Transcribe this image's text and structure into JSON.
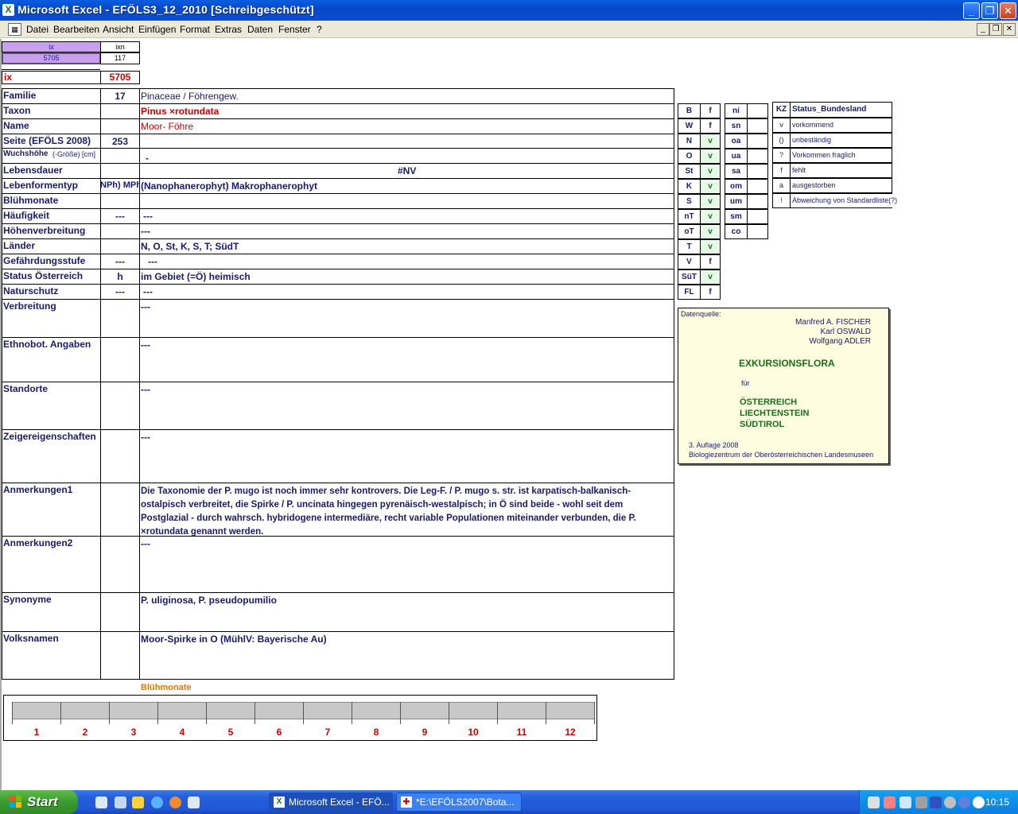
{
  "window": {
    "title": "Microsoft Excel - EFÖLS3_12_2010  [Schreibgeschützt]"
  },
  "menu": [
    "Datei",
    "Bearbeiten",
    "Ansicht",
    "Einfügen",
    "Format",
    "Extras",
    "Daten",
    "Fenster",
    "?"
  ],
  "top_cells": {
    "ix_head": "ix",
    "ixn_head": "ixn",
    "ix_val": "5705",
    "ixn_val": "117",
    "ix_label": "ix",
    "ix_big": "5705"
  },
  "fields": [
    {
      "label": "Familie",
      "code": "17",
      "value": "Pinaceae  /  Föhrengew."
    },
    {
      "label": "Taxon",
      "code": "",
      "value": "Pinus ×rotundata"
    },
    {
      "label": "Name",
      "code": "",
      "value": "Moor- Föhre"
    },
    {
      "label": "Seite (EFÖLS 2008)",
      "code": "253",
      "value": ""
    },
    {
      "label": "Wuchshöhe",
      "label_suffix": "(-Größe) [cm]",
      "code": "",
      "value": "-"
    },
    {
      "label": "Lebensdauer",
      "code": "",
      "value": "#NV"
    },
    {
      "label": "Lebenformentyp",
      "code": "NPh) MPh",
      "value": "(Nanophanerophyt) Makrophanerophyt"
    },
    {
      "label": "Blühmonate",
      "code": "",
      "value": ""
    },
    {
      "label": "Häufigkeit",
      "code": "---",
      "value": "---"
    },
    {
      "label": "Höhenverbreitung",
      "code": "",
      "value": "---"
    },
    {
      "label": "Länder",
      "code": "",
      "value": "N, O, St, K, S, T; SüdT"
    },
    {
      "label": "Gefährdungsstufe",
      "code": "---",
      "value": "---"
    },
    {
      "label": "Status Österreich",
      "code": "h",
      "value": "im Gebiet (=Ö) heimisch"
    },
    {
      "label": "Naturschutz",
      "code": "---",
      "value": "---"
    },
    {
      "label": "Verbreitung",
      "code": "",
      "value": "---"
    },
    {
      "label": "Ethnobot. Angaben",
      "code": "",
      "value": "---"
    },
    {
      "label": "Standorte",
      "code": "",
      "value": "---"
    },
    {
      "label": "Zeigereigenschaften",
      "code": "",
      "value": "---"
    },
    {
      "label": "Anmerkungen1",
      "code": "",
      "value": "Die Taxonomie der P. mugo ist noch immer sehr kontrovers. Die Leg-F. / P. mugo s. str. ist karpatisch-balkanisch-ostalpisch verbreitet, die Spirke / P. uncinata hingegen pyrenäisch-westalpisch; in Ö sind beide - wohl seit dem Postglazial - durch wahrsch. hybridogene intermediäre, recht variable Populationen miteinander verbunden, die P. ×rotundata genannt werden."
    },
    {
      "label": "Anmerkungen2",
      "code": "",
      "value": "---"
    },
    {
      "label": "Synonyme",
      "code": "",
      "value": "P. uliginosa, P. pseudopumilio"
    },
    {
      "label": "Volksnamen",
      "code": "",
      "value": "Moor-Spirke in O (MühlV: Bayerische Au)"
    }
  ],
  "regions": [
    {
      "code": "B",
      "val": "f"
    },
    {
      "code": "W",
      "val": "f"
    },
    {
      "code": "N",
      "val": "v"
    },
    {
      "code": "O",
      "val": "v"
    },
    {
      "code": "St",
      "val": "v"
    },
    {
      "code": "K",
      "val": "v"
    },
    {
      "code": "S",
      "val": "v"
    },
    {
      "code": "nT",
      "val": "v"
    },
    {
      "code": "oT",
      "val": "v"
    },
    {
      "code": "T",
      "val": "v"
    },
    {
      "code": "V",
      "val": "f"
    },
    {
      "code": "SüT",
      "val": "v"
    },
    {
      "code": "FL",
      "val": "f"
    }
  ],
  "altitude": [
    "ni",
    "sn",
    "oa",
    "ua",
    "sa",
    "om",
    "um",
    "sm",
    "co"
  ],
  "legend": {
    "head_kz": "KZ",
    "head_status": "Status_Bundesland",
    "rows": [
      {
        "kz": "v",
        "text": "vorkommend"
      },
      {
        "kz": "()",
        "text": "unbeständig"
      },
      {
        "kz": "?",
        "text": "Vorkommen fraglich"
      },
      {
        "kz": "f",
        "text": "fehlt"
      },
      {
        "kz": "a",
        "text": "ausgestorben"
      },
      {
        "kz": "!",
        "text": "Abweichung von Standardliste(?)"
      }
    ]
  },
  "source": {
    "label": "Datenquelle:",
    "authors": [
      "Manfred A. FISCHER",
      "Karl OSWALD",
      "Wolfgang ADLER"
    ],
    "title": "EXKURSIONSFLORA",
    "fuer": "für",
    "countries": [
      "ÖSTERREICH",
      "LIECHTENSTEIN",
      "SÜDTIROL"
    ],
    "edition": "3. Auflage 2008",
    "publisher": "Biologiezentrum der Oberösterreichischen Landesmuseen"
  },
  "bloom": {
    "title": "Blühmonate",
    "months": [
      "1",
      "2",
      "3",
      "4",
      "5",
      "6",
      "7",
      "8",
      "9",
      "10",
      "11",
      "12"
    ]
  },
  "taskbar": {
    "start": "Start",
    "items": [
      "Microsoft Excel - EFÖ...",
      "*E:\\EFÖLS2007\\Bota..."
    ],
    "clock": "10:15"
  },
  "colors": {
    "accent_purple": "#c9a0f0",
    "legend_bg": "#fffde0",
    "red": "#d00000",
    "green": "#1a6e1a",
    "orange": "#e07800",
    "navy": "#1a1a6e"
  }
}
